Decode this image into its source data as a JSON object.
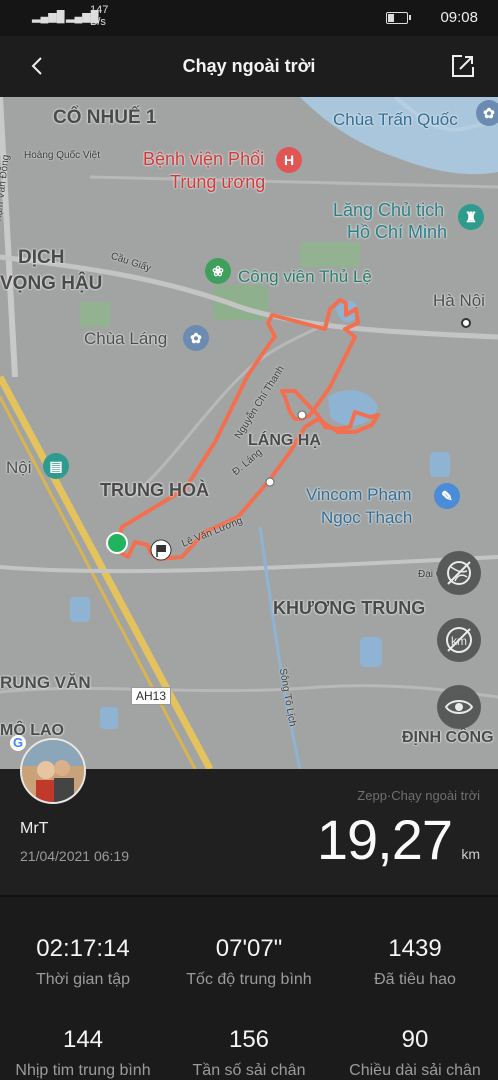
{
  "status_bar": {
    "network_speed": "147",
    "network_unit": "B/s",
    "time": "09:08"
  },
  "header": {
    "title": "Chạy ngoài trời"
  },
  "map": {
    "places": {
      "co_nhue": "CỔ NHUẾ 1",
      "chua_tran_quoc": "Chùa Trấn Quốc",
      "pham_van_dong": "Phạm Văn Đồng",
      "hoang_quoc_viet": "Hoàng Quốc Việt",
      "benh_vien_1": "Bệnh viện Phổi",
      "benh_vien_2": "Trung ương",
      "lang_1": "Lăng Chủ tịch",
      "lang_2": "Hồ Chí Minh",
      "dich_1": "DỊCH",
      "dich_2": "VỌNG HẬU",
      "cau_giay": "Cầu Giấy",
      "cong_vien": "Công viên Thủ Lệ",
      "ha_noi": "Hà Nội",
      "chua_lang": "Chùa Láng",
      "nguyen_chi_thanh": "Nguyễn Chí Thanh",
      "lang_ha": "LÁNG HẠ",
      "noi": "Nội",
      "d_lang": "Đ. Láng",
      "trung_hoa": "TRUNG HOÀ",
      "vincom_1": "Vincom Phạm",
      "vincom_2": "Ngọc Thạch",
      "le_van_luong": "Lê Văn Lương",
      "dai_co": "Đại Cồ",
      "khuong_trung": "KHƯƠNG TRUNG",
      "song_to_lich": "Sông Tô Lịch",
      "trung_van": "RUNG VĂN",
      "ah13": "AH13",
      "dinh_cong": "ĐỊNH CÔNG",
      "me_lao": "MỘ LAO"
    },
    "hospital_pin": "H",
    "route_color": "#f2704f",
    "start_color": "#22b35f"
  },
  "profile": {
    "username": "MrT",
    "datetime": "21/04/2021 06:19",
    "source": "Zepp·Chạy ngoài trời",
    "distance": "19,27",
    "distance_unit": "km"
  },
  "stats": [
    {
      "value": "02:17:14",
      "label": "Thời gian tập"
    },
    {
      "value": "07'07\"",
      "label": "Tốc độ trung bình"
    },
    {
      "value": "1439",
      "label": "Đã tiêu hao"
    },
    {
      "value": "144",
      "label": "Nhịp tim trung bình"
    },
    {
      "value": "156",
      "label": "Tần số sải chân"
    },
    {
      "value": "90",
      "label": "Chiều dài sải chân"
    }
  ]
}
